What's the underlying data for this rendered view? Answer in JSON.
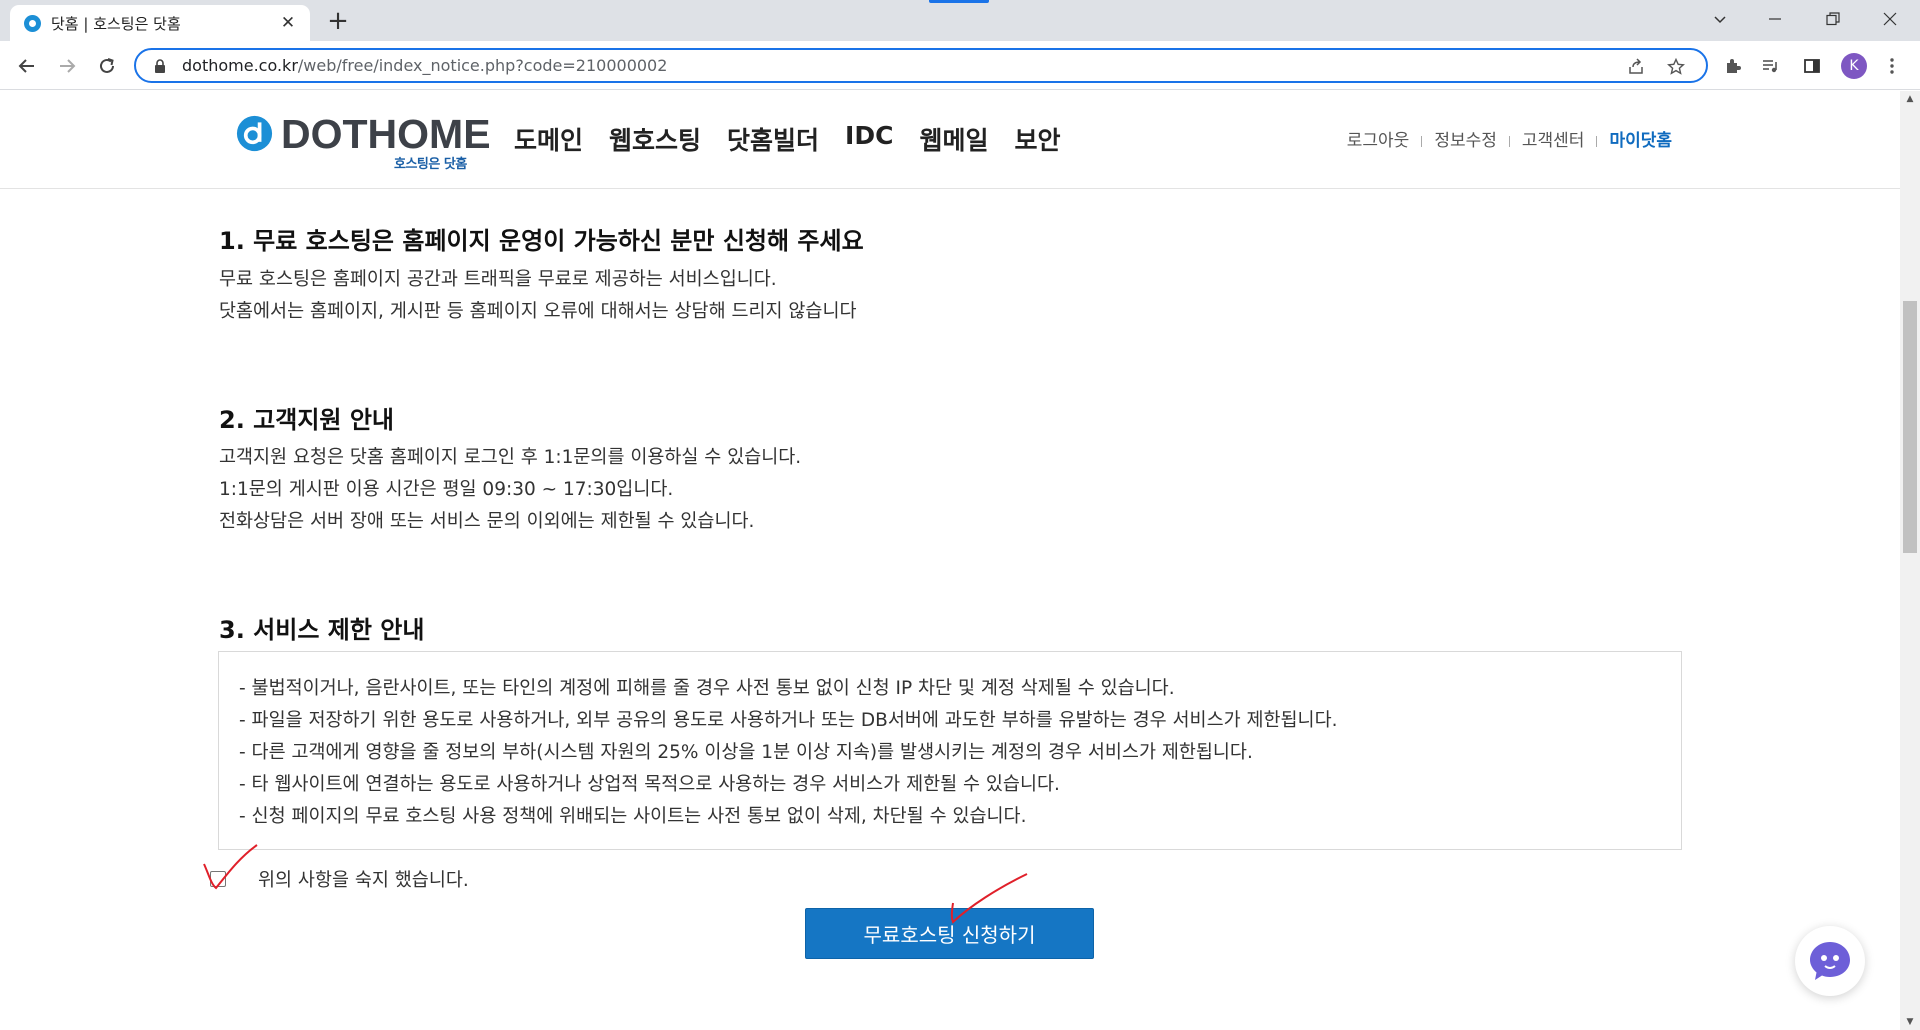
{
  "browser": {
    "tab_title": "닷홈 | 호스팅은 닷홈",
    "tab_close": "✕",
    "new_tab": "+",
    "url_host": "dothome.co.kr",
    "url_path": "/web/free/index_notice.php?code=210000002",
    "avatar_initial": "K",
    "accent_color": "#1a73e8"
  },
  "header": {
    "logo_text": "DOTHOME",
    "logo_sub": "호스팅은 닷홈",
    "brand_color": "#1c8fd6",
    "nav": [
      "도메인",
      "웹호스팅",
      "닷홈빌더",
      "IDC",
      "웹메일",
      "보안"
    ],
    "util": [
      "로그아웃",
      "정보수정",
      "고객센터",
      "마이닷홈"
    ]
  },
  "content": {
    "section1": {
      "title": "1. 무료 호스팅은 홈페이지 운영이 가능하신 분만 신청해 주세요",
      "lines": [
        "무료 호스팅은 홈페이지 공간과 트래픽을 무료로 제공하는 서비스입니다.",
        "닷홈에서는 홈페이지, 게시판 등 홈페이지 오류에 대해서는 상담해 드리지 않습니다"
      ]
    },
    "section2": {
      "title": "2. 고객지원 안내",
      "lines": [
        "고객지원 요청은 닷홈 홈페이지 로그인 후 1:1문의를 이용하실 수 있습니다.",
        "1:1문의 게시판 이용 시간은 평일 09:30 ~ 17:30입니다.",
        "전화상담은 서버 장애 또는 서비스 문의 이외에는 제한될 수 있습니다."
      ]
    },
    "section3": {
      "title": "3. 서비스 제한 안내",
      "lines": [
        "- 불법적이거나, 음란사이트, 또는 타인의 계정에 피해를 줄 경우 사전 통보 없이 신청 IP 차단 및 계정 삭제될 수 있습니다.",
        "- 파일을 저장하기 위한 용도로 사용하거나, 외부 공유의 용도로 사용하거나 또는 DB서버에 과도한 부하를 유발하는 경우 서비스가 제한됩니다.",
        "- 다른 고객에게 영향을 줄 정보의 부하(시스템 자원의 25% 이상을 1분 이상 지속)를 발생시키는 계정의 경우 서비스가 제한됩니다.",
        "- 타 웹사이트에 연결하는 용도로 사용하거나 상업적 목적으로 사용하는 경우 서비스가 제한될 수 있습니다.",
        "- 신청 페이지의 무료 호스팅 사용 정책에 위배되는 사이트는 사전 통보 없이 삭제, 차단될 수 있습니다."
      ]
    },
    "agree_label": "위의 사항을 숙지 했습니다.",
    "agree_checked": false,
    "apply_button": "무료호스팅 신청하기",
    "button_color": "#1576c4",
    "annotation_color": "#e0202a"
  }
}
